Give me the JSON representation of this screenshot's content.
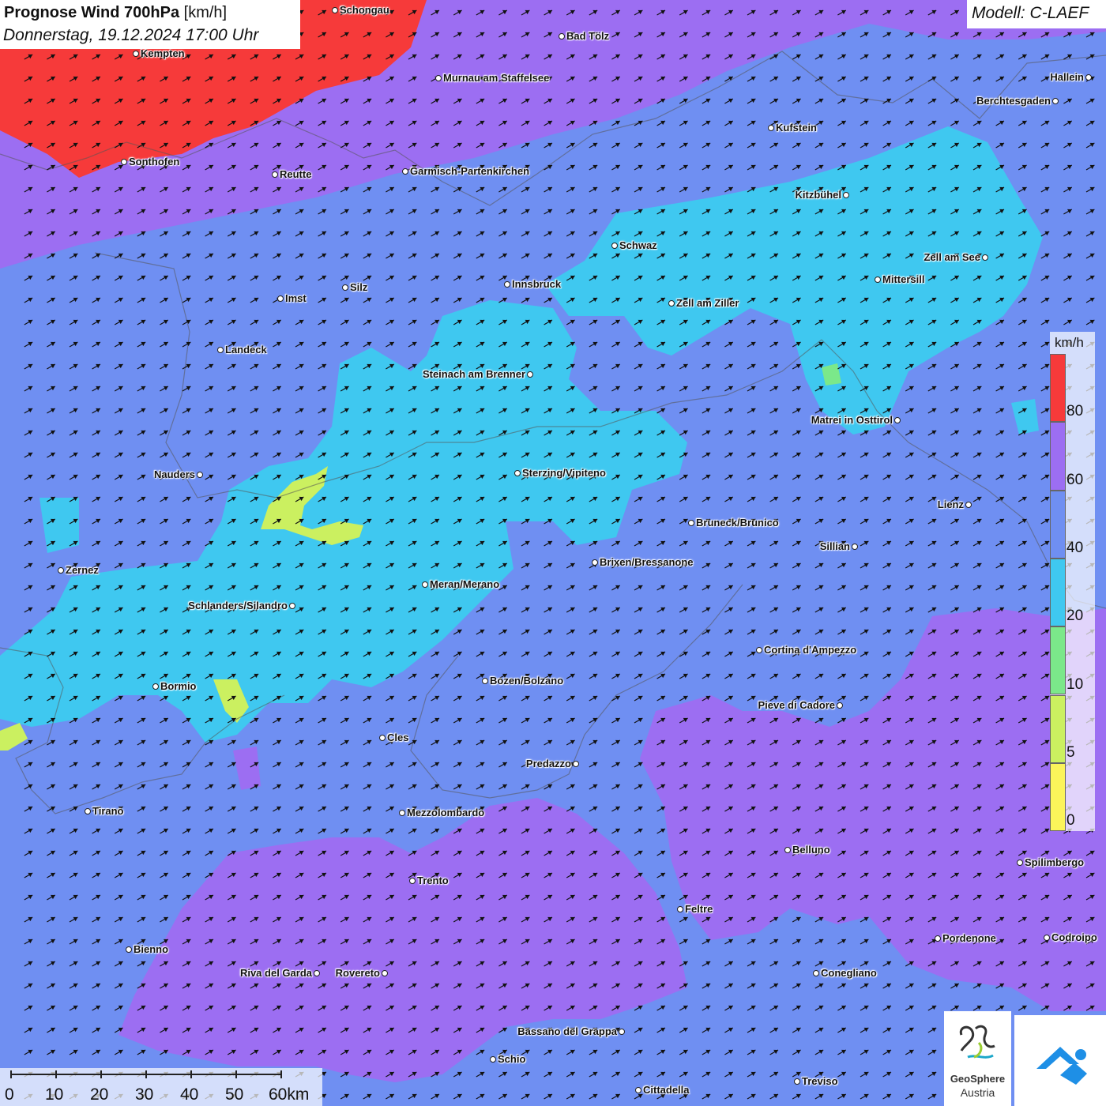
{
  "title": {
    "product": "Prognose Wind 700hPa",
    "unit": "[km/h]",
    "datetime": "Donnerstag, 19.12.2024 17:00 Uhr"
  },
  "model": "Modell: C-LAEF",
  "legend": {
    "unit": "km/h",
    "classes": [
      {
        "from": 80,
        "color": "#f63a3a"
      },
      {
        "from": 60,
        "color": "#9c6ef2"
      },
      {
        "from": 40,
        "color": "#6f8ff2"
      },
      {
        "from": 20,
        "color": "#3fc8f0"
      },
      {
        "from": 10,
        "color": "#7be88a"
      },
      {
        "from": 5,
        "color": "#cbf060"
      },
      {
        "from": 0,
        "color": "#fbf45a"
      }
    ],
    "ticks": [
      "80",
      "60",
      "40",
      "20",
      "10",
      "5",
      "0"
    ]
  },
  "scalebar": {
    "labels": [
      "0",
      "10",
      "20",
      "30",
      "40",
      "50",
      "60km"
    ]
  },
  "logos": {
    "geosphere_line1": "GeoSphere",
    "geosphere_line2": "Austria",
    "geosphere_icon": "geosphere-swirl-icon",
    "app_icon": "wind-app-icon"
  },
  "wind_arrows": {
    "direction_to_deg": 60,
    "color": "#111111"
  },
  "places": [
    "Schongau",
    "Bad Tölz",
    "Kempten",
    "Murnau am Staffelsee",
    "Hallein",
    "Berchtesgaden",
    "Kufstein",
    "Sonthofen",
    "Reutte",
    "Garmisch-Partenkirchen",
    "Kitzbühel",
    "Schwaz",
    "Zell am See",
    "Mittersill",
    "Innsbruck",
    "Silz",
    "Imst",
    "Zell am Ziller",
    "Landeck",
    "Steinach am Brenner",
    "Matrei in Osttirol",
    "Nauders",
    "Sterzing/Vipiteno",
    "Lienz",
    "Bruneck/Brunico",
    "Sillian",
    "Brixen/Bressanone",
    "Zernez",
    "Meran/Merano",
    "Schlanders/Silandro",
    "Cortina d'Ampezzo",
    "Bozen/Bolzano",
    "Bormio",
    "Pieve di Cadore",
    "Cles",
    "Predazzo",
    "Tirano",
    "Mezzolombardo",
    "Belluno",
    "Spilimbergo",
    "Trento",
    "Feltre",
    "Pordenone",
    "Codroipo",
    "Bienno",
    "Riva del Garda",
    "Rovereto",
    "Conegliano",
    "Bassano del Grappa",
    "Schio",
    "Treviso",
    "Cittadella"
  ]
}
